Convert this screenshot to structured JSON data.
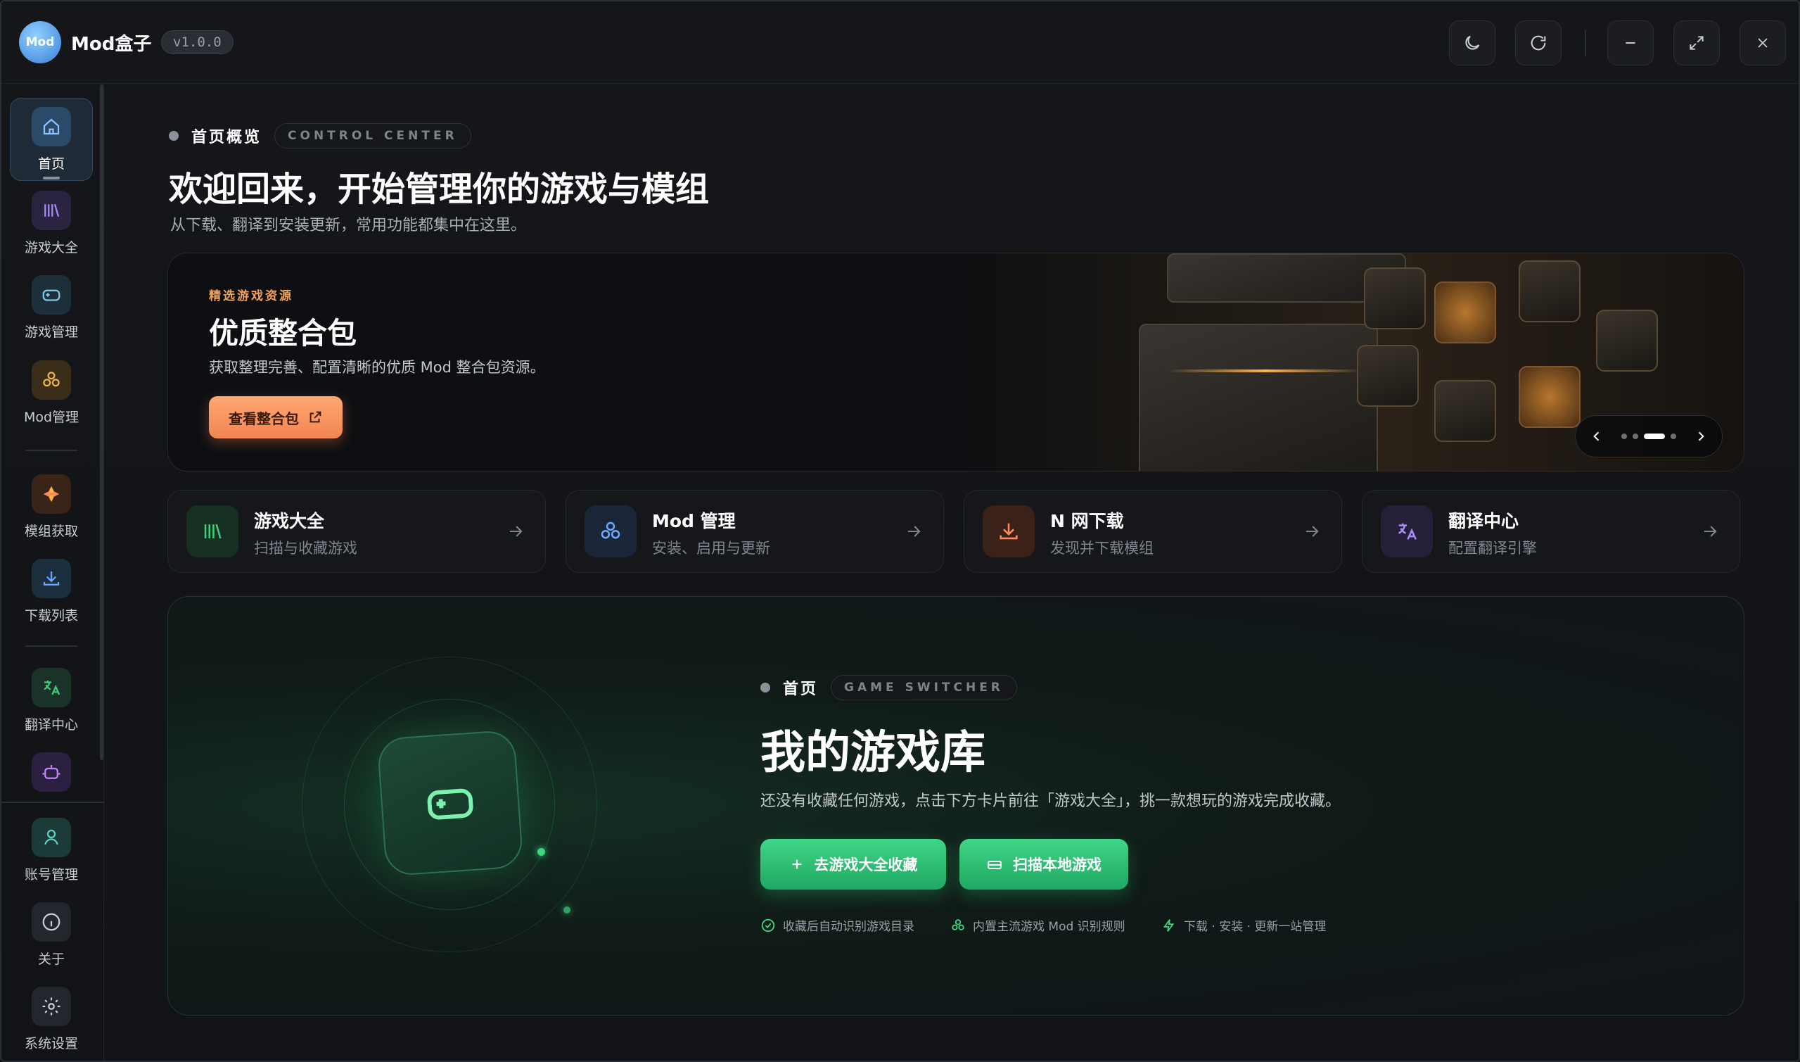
{
  "app": {
    "name": "Mod盒子",
    "logo_text": "Mod",
    "version": "v1.0.0"
  },
  "titlebar": {
    "buttons": [
      "moon-icon",
      "refresh-icon",
      "minimize-icon",
      "maximize-icon",
      "close-icon"
    ]
  },
  "sidebar": {
    "items": [
      {
        "label": "首页",
        "icon": "home-icon",
        "active": true
      },
      {
        "label": "游戏大全",
        "icon": "library-icon"
      },
      {
        "label": "游戏管理",
        "icon": "gamepad-icon"
      },
      {
        "label": "Mod管理",
        "icon": "blocks-icon"
      },
      {
        "label": "模组获取",
        "icon": "mod-fetch-icon"
      },
      {
        "label": "下载列表",
        "icon": "download-icon"
      },
      {
        "label": "翻译中心",
        "icon": "translate-icon"
      },
      {
        "label": "",
        "icon": "robot-icon"
      },
      {
        "label": "账号管理",
        "icon": "user-icon"
      },
      {
        "label": "关于",
        "icon": "info-icon"
      },
      {
        "label": "系统设置",
        "icon": "gear-icon"
      }
    ]
  },
  "header": {
    "eyebrow": "首页概览",
    "eyebrow_pill": "CONTROL CENTER",
    "title": "欢迎回来，开始管理你的游戏与模组",
    "subtitle": "从下载、翻译到安装更新，常用功能都集中在这里。"
  },
  "banner": {
    "tag": "精选游戏资源",
    "title": "优质整合包",
    "description": "获取整理完善、配置清晰的优质 Mod 整合包资源。",
    "button": "查看整合包",
    "carousel_index": 3,
    "carousel_count": 4
  },
  "quick_cards": [
    {
      "title": "游戏大全",
      "subtitle": "扫描与收藏游戏",
      "icon": "library-icon",
      "color": "#3ecf7a"
    },
    {
      "title": "Mod 管理",
      "subtitle": "安装、启用与更新",
      "icon": "blocks-icon",
      "color": "#6aa8ff"
    },
    {
      "title": "N 网下载",
      "subtitle": "发现并下载模组",
      "icon": "download-icon",
      "color": "#ff8a5b"
    },
    {
      "title": "翻译中心",
      "subtitle": "配置翻译引擎",
      "icon": "translate-icon",
      "color": "#a78bfa"
    }
  ],
  "library": {
    "eyebrow": "首页",
    "eyebrow_pill": "GAME SWITCHER",
    "title": "我的游戏库",
    "subtitle": "还没有收藏任何游戏，点击下方卡片前往「游戏大全」，挑一款想玩的游戏完成收藏。",
    "primary_button": "去游戏大全收藏",
    "secondary_button": "扫描本地游戏",
    "features": [
      {
        "text": "收藏后自动识别游戏目录",
        "icon": "check-circle-icon"
      },
      {
        "text": "内置主流游戏 Mod 识别规则",
        "icon": "blocks-icon"
      },
      {
        "text": "下载 · 安装 · 更新一站管理",
        "icon": "bolt-icon"
      }
    ]
  },
  "colors": {
    "accent_green": "#3ed67f",
    "accent_orange": "#f28552",
    "background": "#111317"
  }
}
